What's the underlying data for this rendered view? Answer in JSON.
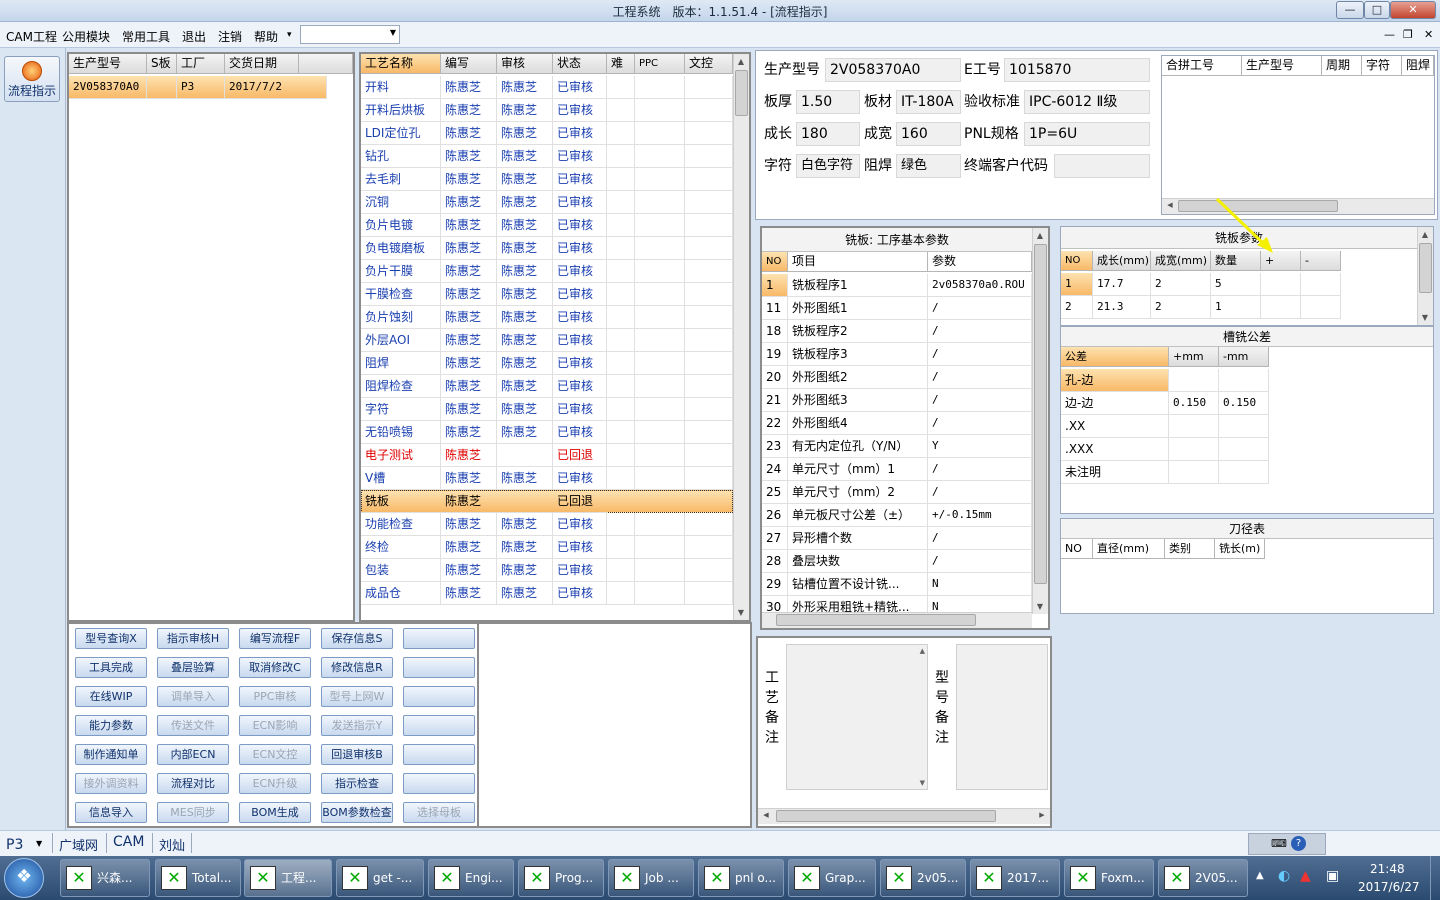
{
  "window": {
    "title": "工程系统　版本：1.1.51.4 - [流程指示]",
    "btn_min": "—",
    "btn_max": "□",
    "btn_close": "✕"
  },
  "menu": {
    "items": [
      "CAM工程",
      "公用模块",
      "常用工具",
      "退出",
      "注销",
      "帮助"
    ],
    "help_arrow": "▾",
    "combo_value": ""
  },
  "mdi": {
    "min": "—",
    "restore": "❐",
    "close": "✕"
  },
  "sidebar": {
    "flow_label": "流程指示"
  },
  "jobs": {
    "headers": [
      "生产型号",
      "S板",
      "工厂",
      "交货日期"
    ],
    "rows": [
      {
        "model": "2V058370A0",
        "s": "",
        "factory": "P3",
        "date": "2017/7/2"
      }
    ]
  },
  "process": {
    "headers": [
      "工艺名称",
      "编写",
      "审核",
      "状态",
      "难",
      "PPC",
      "文控"
    ],
    "rows": [
      {
        "name": "开料",
        "writer": "陈惠芝",
        "auditor": "陈惠芝",
        "status": "已审核",
        "style": "blue"
      },
      {
        "name": "开料后烘板",
        "writer": "陈惠芝",
        "auditor": "陈惠芝",
        "status": "已审核",
        "style": "blue"
      },
      {
        "name": "LDI定位孔",
        "writer": "陈惠芝",
        "auditor": "陈惠芝",
        "status": "已审核",
        "style": "blue"
      },
      {
        "name": "钻孔",
        "writer": "陈惠芝",
        "auditor": "陈惠芝",
        "status": "已审核",
        "style": "blue"
      },
      {
        "name": "去毛刺",
        "writer": "陈惠芝",
        "auditor": "陈惠芝",
        "status": "已审核",
        "style": "blue"
      },
      {
        "name": "沉铜",
        "writer": "陈惠芝",
        "auditor": "陈惠芝",
        "status": "已审核",
        "style": "blue"
      },
      {
        "name": "负片电镀",
        "writer": "陈惠芝",
        "auditor": "陈惠芝",
        "status": "已审核",
        "style": "blue"
      },
      {
        "name": "负电镀磨板",
        "writer": "陈惠芝",
        "auditor": "陈惠芝",
        "status": "已审核",
        "style": "blue"
      },
      {
        "name": "负片干膜",
        "writer": "陈惠芝",
        "auditor": "陈惠芝",
        "status": "已审核",
        "style": "blue"
      },
      {
        "name": "干膜检查",
        "writer": "陈惠芝",
        "auditor": "陈惠芝",
        "status": "已审核",
        "style": "blue"
      },
      {
        "name": "负片蚀刻",
        "writer": "陈惠芝",
        "auditor": "陈惠芝",
        "status": "已审核",
        "style": "blue"
      },
      {
        "name": "外层AOI",
        "writer": "陈惠芝",
        "auditor": "陈惠芝",
        "status": "已审核",
        "style": "blue"
      },
      {
        "name": "阻焊",
        "writer": "陈惠芝",
        "auditor": "陈惠芝",
        "status": "已审核",
        "style": "blue"
      },
      {
        "name": "阻焊检查",
        "writer": "陈惠芝",
        "auditor": "陈惠芝",
        "status": "已审核",
        "style": "blue"
      },
      {
        "name": "字符",
        "writer": "陈惠芝",
        "auditor": "陈惠芝",
        "status": "已审核",
        "style": "blue"
      },
      {
        "name": "无铅喷锡",
        "writer": "陈惠芝",
        "auditor": "陈惠芝",
        "status": "已审核",
        "style": "blue"
      },
      {
        "name": "电子测试",
        "writer": "陈惠芝",
        "auditor": "",
        "status": "已回退",
        "style": "red"
      },
      {
        "name": "V槽",
        "writer": "陈惠芝",
        "auditor": "陈惠芝",
        "status": "已审核",
        "style": "blue"
      },
      {
        "name": "铣板",
        "writer": "陈惠芝",
        "auditor": "",
        "status": "已回退",
        "style": "sel"
      },
      {
        "name": "功能检查",
        "writer": "陈惠芝",
        "auditor": "陈惠芝",
        "status": "已审核",
        "style": "blue"
      },
      {
        "name": "终检",
        "writer": "陈惠芝",
        "auditor": "陈惠芝",
        "status": "已审核",
        "style": "blue"
      },
      {
        "name": "包装",
        "writer": "陈惠芝",
        "auditor": "陈惠芝",
        "status": "已审核",
        "style": "blue"
      },
      {
        "name": "成品仓",
        "writer": "陈惠芝",
        "auditor": "陈惠芝",
        "status": "已审核",
        "style": "blue"
      }
    ]
  },
  "buttons": [
    [
      "型号查询X",
      "指示审核H",
      "编写流程F",
      "保存信息S",
      ""
    ],
    [
      "工具完成",
      "叠层验算",
      "取消修改C",
      "修改信息R",
      ""
    ],
    [
      "在线WIP",
      "调单导入",
      "PPC审核",
      "型号上网W",
      ""
    ],
    [
      "能力参数",
      "传送文件",
      "ECN影响",
      "发送指示Y",
      ""
    ],
    [
      "制作通知单",
      "内部ECN",
      "ECN文控",
      "回退审核B",
      ""
    ],
    [
      "接外调资料",
      "流程对比",
      "ECN升级",
      "指示检查",
      ""
    ],
    [
      "信息导入",
      "MES同步",
      "BOM生成",
      "BOM参数检查",
      "选择母板"
    ]
  ],
  "buttons_disabled": [
    [
      false,
      false,
      false,
      false,
      false
    ],
    [
      false,
      false,
      false,
      false,
      false
    ],
    [
      false,
      true,
      true,
      true,
      false
    ],
    [
      false,
      true,
      true,
      true,
      false
    ],
    [
      false,
      false,
      true,
      false,
      false
    ],
    [
      true,
      false,
      true,
      false,
      false
    ],
    [
      false,
      true,
      false,
      false,
      true
    ]
  ],
  "info": {
    "model_label": "生产型号",
    "model": "2V058370A0",
    "e_label": "E工号",
    "e": "1015870",
    "thick_label": "板厚",
    "thick": "1.50",
    "mat_label": "板材",
    "mat": "IT-180A",
    "std_label": "验收标准",
    "std": "IPC-6012 Ⅱ级",
    "len_label": "成长",
    "len": "180",
    "wid_label": "成宽",
    "wid": "160",
    "pnl_label": "PNL规格",
    "pnl": "1P=6U",
    "char_label": "字符",
    "char": "白色字符",
    "mask_label": "阻焊",
    "mask": "绿色",
    "cust_label": "终端客户代码",
    "cust": ""
  },
  "merge": {
    "headers": [
      "合拼工号",
      "生产型号",
      "周期",
      "字符",
      "阻焊"
    ]
  },
  "params": {
    "title": "铣板: 工序基本参数",
    "headers": [
      "NO",
      "项目",
      "参数"
    ],
    "rows": [
      [
        "1",
        "铣板程序1",
        "2v058370a0.ROU"
      ],
      [
        "11",
        "外形图纸1",
        "/"
      ],
      [
        "18",
        "铣板程序2",
        "/"
      ],
      [
        "19",
        "铣板程序3",
        "/"
      ],
      [
        "20",
        "外形图纸2",
        "/"
      ],
      [
        "21",
        "外形图纸3",
        "/"
      ],
      [
        "22",
        "外形图纸4",
        "/"
      ],
      [
        "23",
        "有无内定位孔（Y/N）",
        "Y"
      ],
      [
        "24",
        "单元尺寸（mm）1",
        "/"
      ],
      [
        "25",
        "单元尺寸（mm）2",
        "/"
      ],
      [
        "26",
        "单元板尺寸公差（±）",
        "+/-0.15mm"
      ],
      [
        "27",
        "异形槽个数",
        "/"
      ],
      [
        "28",
        "叠层块数",
        "/"
      ],
      [
        "29",
        "钻槽位置不设计铣...",
        "N"
      ],
      [
        "30",
        "外形采用粗铣+精铣...",
        "N"
      ]
    ]
  },
  "mill": {
    "title": "铣板参数",
    "headers": [
      "NO",
      "成长(mm)",
      "成宽(mm)",
      "数量",
      "+",
      "-"
    ],
    "rows": [
      [
        "1",
        "17.7",
        "2",
        "5",
        "",
        ""
      ],
      [
        "2",
        "21.3",
        "2",
        "1",
        "",
        ""
      ]
    ]
  },
  "tol": {
    "title": "槽铣公差",
    "headers": [
      "公差",
      "+mm",
      "-mm"
    ],
    "rows": [
      [
        "孔-边",
        "",
        ""
      ],
      [
        "边-边",
        "0.150",
        "0.150"
      ],
      [
        ".XX",
        "",
        ""
      ],
      [
        ".XXX",
        "",
        ""
      ],
      [
        "未注明",
        "",
        ""
      ]
    ]
  },
  "knife": {
    "title": "刀径表",
    "headers": [
      "NO",
      "直径(mm)",
      "类别",
      "铣长(m)"
    ]
  },
  "remarks": {
    "proc": "工艺备注",
    "model": "型号备注"
  },
  "status": {
    "factory": "P3",
    "items": [
      "广域网",
      "CAM",
      "刘灿"
    ]
  },
  "taskbar": {
    "items": [
      "兴森...",
      "Total...",
      "工程...",
      "get -...",
      "Engi...",
      "Prog...",
      "Job ...",
      "pnl o...",
      "Grap...",
      "2v05...",
      "2017...",
      "Foxm...",
      "2V05..."
    ],
    "time": "21:48",
    "date": "2017/6/27"
  }
}
